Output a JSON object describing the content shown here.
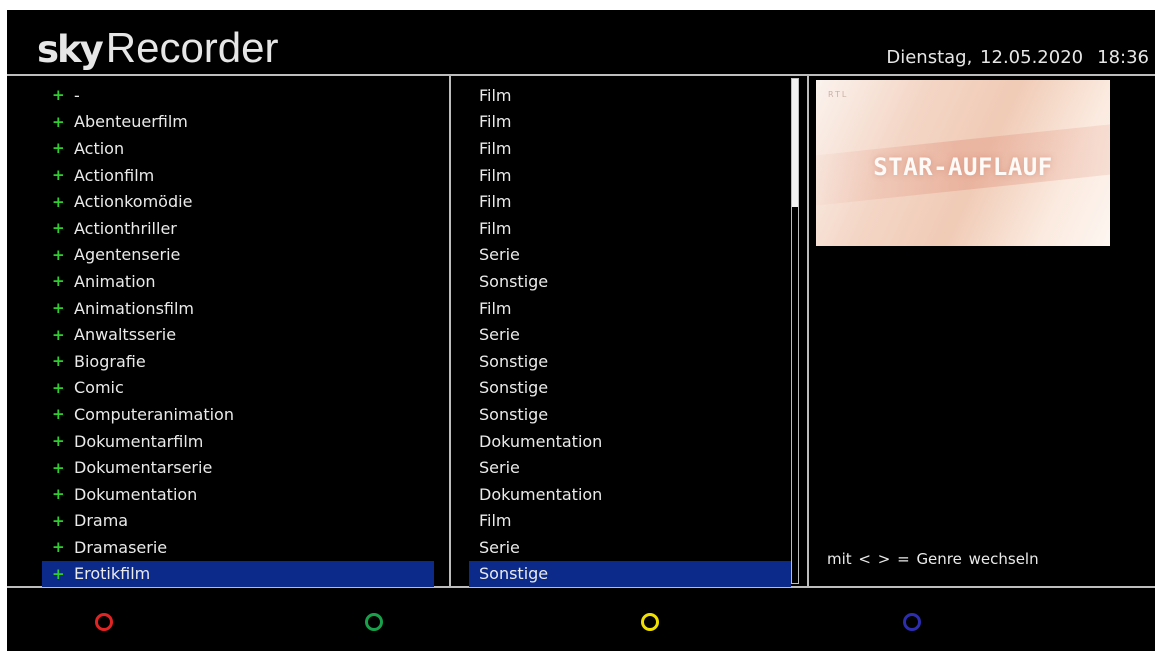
{
  "header": {
    "logo_sky": "sky",
    "logo_recorder": "Recorder",
    "date": "Dienstag, 12.05.2020",
    "time": "18:36"
  },
  "genres": [
    {
      "name": "-",
      "type": "Film"
    },
    {
      "name": "Abenteuerfilm",
      "type": "Film"
    },
    {
      "name": "Action",
      "type": "Film"
    },
    {
      "name": "Actionfilm",
      "type": "Film"
    },
    {
      "name": "Actionkomödie",
      "type": "Film"
    },
    {
      "name": "Actionthriller",
      "type": "Film"
    },
    {
      "name": "Agentenserie",
      "type": "Serie"
    },
    {
      "name": "Animation",
      "type": "Sonstige"
    },
    {
      "name": "Animationsfilm",
      "type": "Film"
    },
    {
      "name": "Anwaltsserie",
      "type": "Serie"
    },
    {
      "name": "Biografie",
      "type": "Sonstige"
    },
    {
      "name": "Comic",
      "type": "Sonstige"
    },
    {
      "name": "Computeranimation",
      "type": "Sonstige"
    },
    {
      "name": "Dokumentarfilm",
      "type": "Dokumentation"
    },
    {
      "name": "Dokumentarserie",
      "type": "Serie"
    },
    {
      "name": "Dokumentation",
      "type": "Dokumentation"
    },
    {
      "name": "Drama",
      "type": "Film"
    },
    {
      "name": "Dramaserie",
      "type": "Serie"
    },
    {
      "name": "Erotikfilm",
      "type": "Sonstige"
    }
  ],
  "selected_index": 18,
  "plus_symbol": "+",
  "preview": {
    "title": "STAR-AUFLAUF",
    "watermark": "RTL"
  },
  "hint": "mit < > = Genre wechseln",
  "buttons": [
    {
      "name": "red",
      "color": "#e02323"
    },
    {
      "name": "green",
      "color": "#18a04a"
    },
    {
      "name": "yellow",
      "color": "#f0e000"
    },
    {
      "name": "blue",
      "color": "#2d2db0"
    }
  ],
  "colors": {
    "selection": "#0b2a8a",
    "plus": "#2fce2f",
    "background": "#000000"
  }
}
